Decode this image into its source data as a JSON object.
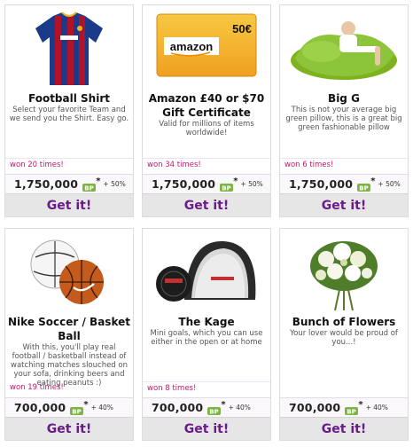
{
  "colors": {
    "won": "#c2186b",
    "get_it": "#6a1b8a",
    "bp_green": "#7cb342"
  },
  "products": [
    {
      "title": "Football Shirt",
      "description": "Select your favorite Team and we send you the Shirt. Easy go.",
      "won": "won 20 times!",
      "price": "1,750,000",
      "bonus": "+ 50%",
      "cta": "Get it!",
      "image": "football-shirt-image"
    },
    {
      "title": "Amazon £40 or $70 Gift Certificate",
      "description": "Valid for millions of items worldwide!",
      "won": "won 34 times!",
      "price": "1,750,000",
      "bonus": "+ 50%",
      "cta": "Get it!",
      "image": "amazon-gift-card-image",
      "image_text": {
        "brand": "amazon",
        "amount": "50€"
      }
    },
    {
      "title": "Big G",
      "description": "This is not your average big green pillow, this is a great big green fashionable pillow",
      "won": "won 6 times!",
      "price": "1,750,000",
      "bonus": "+ 50%",
      "cta": "Get it!",
      "image": "green-beanbag-image"
    },
    {
      "title": "Nike Soccer / Basket Ball",
      "description": "With this, you'll play real football / basketball instead of watching matches slouched on your sofa, drinking beers and eating peanuts :)",
      "won": "won 19 times!",
      "price": "700,000",
      "bonus": "+ 40%",
      "cta": "Get it!",
      "image": "nike-balls-image"
    },
    {
      "title": "The Kage",
      "description": "Mini goals, which you can use either in the open or at home",
      "won": "won 8 times!",
      "price": "700,000",
      "bonus": "+ 40%",
      "cta": "Get it!",
      "image": "kage-goal-image"
    },
    {
      "title": "Bunch of Flowers",
      "description": "Your lover would be proud of you...!",
      "won": "",
      "price": "700,000",
      "bonus": "+ 40%",
      "cta": "Get it!",
      "image": "flowers-image"
    }
  ]
}
